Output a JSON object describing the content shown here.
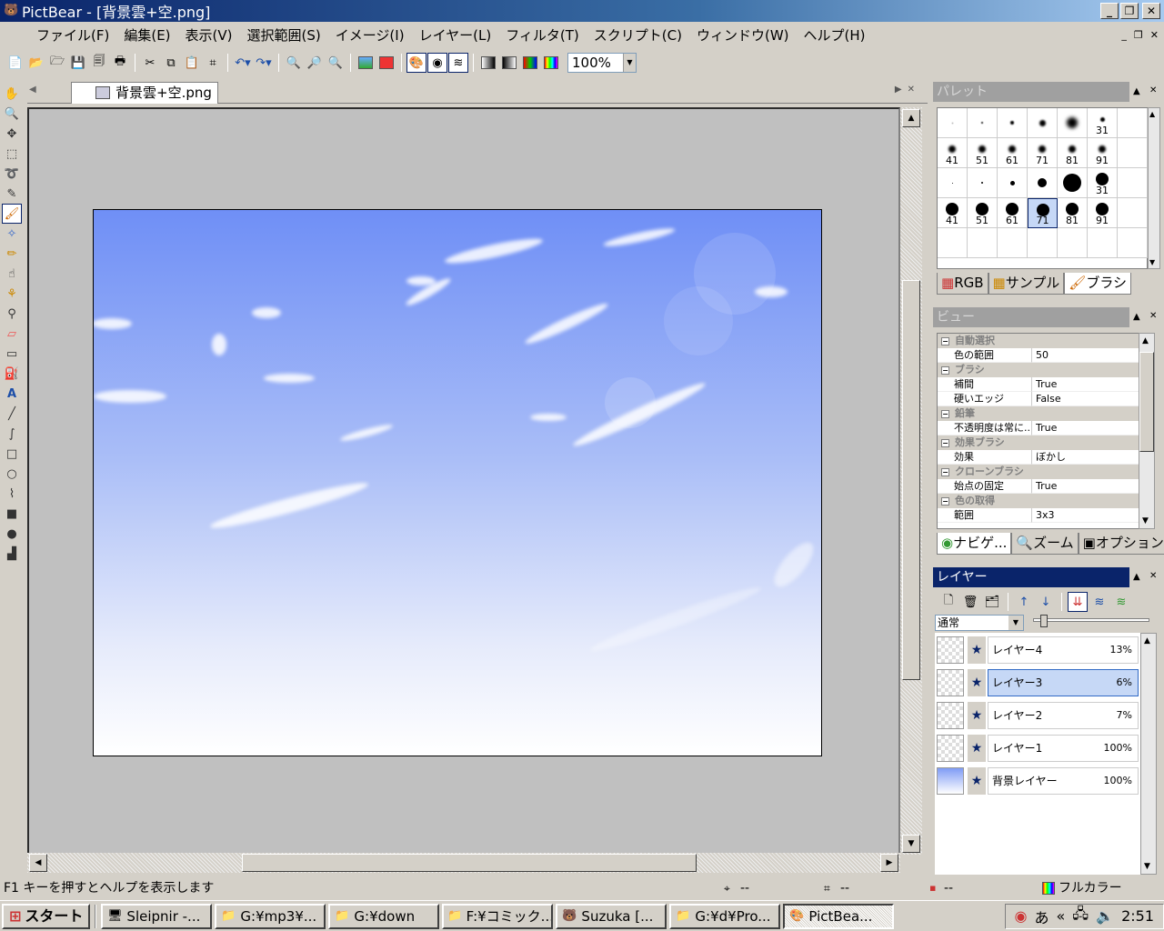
{
  "window": {
    "title": "PictBear - [背景雲+空.png]",
    "min": "_",
    "restore": "❐",
    "close": "✕"
  },
  "menu": [
    "ファイル(F)",
    "編集(E)",
    "表示(V)",
    "選択範囲(S)",
    "イメージ(I)",
    "レイヤー(L)",
    "フィルタ(T)",
    "スクリプト(C)",
    "ウィンドウ(W)",
    "ヘルプ(H)"
  ],
  "mdi": {
    "min": "_",
    "restore": "❐",
    "close": "✕"
  },
  "toolbar": {
    "zoom": "100%"
  },
  "document": {
    "tab": "背景雲+空.png"
  },
  "palette": {
    "title": "パレット",
    "brush_rows": [
      [
        {
          "size": 1,
          "label": ""
        },
        {
          "size": 2,
          "label": ""
        },
        {
          "size": 4,
          "label": ""
        },
        {
          "size": 7,
          "label": ""
        },
        {
          "size": 12,
          "label": ""
        },
        {
          "size": 5,
          "label": "31"
        }
      ],
      [
        {
          "size": 8,
          "label": "41"
        },
        {
          "size": 8,
          "label": "51"
        },
        {
          "size": 8,
          "label": "61"
        },
        {
          "size": 8,
          "label": "71"
        },
        {
          "size": 8,
          "label": "81"
        },
        {
          "size": 8,
          "label": "91"
        }
      ],
      [
        {
          "size": 1,
          "label": ""
        },
        {
          "size": 2,
          "label": ""
        },
        {
          "size": 5,
          "label": ""
        },
        {
          "size": 10,
          "label": ""
        },
        {
          "size": 20,
          "label": ""
        },
        {
          "size": 14,
          "label": "31"
        }
      ],
      [
        {
          "size": 14,
          "label": "41"
        },
        {
          "size": 14,
          "label": "51"
        },
        {
          "size": 14,
          "label": "61"
        },
        {
          "size": 14,
          "label": "71",
          "selected": true
        },
        {
          "size": 14,
          "label": "81"
        },
        {
          "size": 14,
          "label": "91"
        }
      ]
    ],
    "tabs": [
      "RGB",
      "サンプル",
      "ブラシ"
    ]
  },
  "view": {
    "title": "ビュー",
    "rows": [
      {
        "cat": "自動選択"
      },
      {
        "key": "色の範囲",
        "val": "50"
      },
      {
        "cat": "ブラシ"
      },
      {
        "key": "補間",
        "val": "True"
      },
      {
        "key": "硬いエッジ",
        "val": "False"
      },
      {
        "cat": "鉛筆"
      },
      {
        "key": "不透明度は常に...",
        "val": "True"
      },
      {
        "cat": "効果ブラシ"
      },
      {
        "key": "効果",
        "val": "ぼかし"
      },
      {
        "cat": "クローンブラシ"
      },
      {
        "key": "始点の固定",
        "val": "True"
      },
      {
        "cat": "色の取得"
      },
      {
        "key": "範囲",
        "val": "3x3"
      }
    ],
    "tabs": [
      "ナビゲ...",
      "ズーム",
      "オプション"
    ]
  },
  "layers": {
    "title": "レイヤー",
    "blend_mode": "通常",
    "items": [
      {
        "name": "レイヤー4",
        "opacity": "13%"
      },
      {
        "name": "レイヤー3",
        "opacity": "6%",
        "selected": true
      },
      {
        "name": "レイヤー2",
        "opacity": "7%"
      },
      {
        "name": "レイヤー1",
        "opacity": "100%"
      },
      {
        "name": "背景レイヤー",
        "opacity": "100%"
      }
    ]
  },
  "status": {
    "hint": "F1 キーを押すとヘルプを表示します",
    "pos": "--",
    "size": "--",
    "color_info": "--",
    "color_mode": "フルカラー"
  },
  "taskbar": {
    "start": "スタート",
    "tasks": [
      {
        "label": "Sleipnir -...",
        "icon": "🖥"
      },
      {
        "label": "G:¥mp3¥...",
        "icon": "📁"
      },
      {
        "label": "G:¥down",
        "icon": "📁"
      },
      {
        "label": "F:¥コミック...",
        "icon": "📁"
      },
      {
        "label": "Suzuka [...",
        "icon": "🐻"
      },
      {
        "label": "G:¥d¥Pro...",
        "icon": "📁"
      },
      {
        "label": "PictBea...",
        "icon": "🎨",
        "active": true
      }
    ],
    "ime": "あ",
    "tray_arrow": "«",
    "clock": "2:51"
  }
}
